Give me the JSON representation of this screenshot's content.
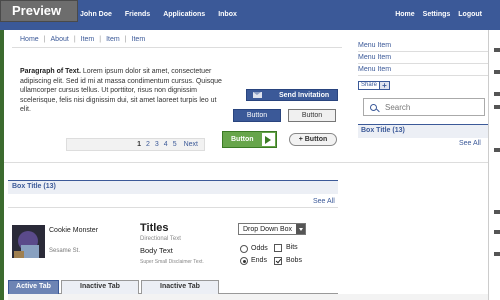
{
  "badge": "Preview",
  "topnav": {
    "left": [
      "John Doe",
      "Friends",
      "Applications",
      "Inbox"
    ],
    "right": [
      "Home",
      "Settings",
      "Logout"
    ]
  },
  "breadcrumb": [
    "Home",
    "About",
    "Item",
    "Item",
    "Item"
  ],
  "breadcrumb_separator": "|",
  "paragraph": {
    "heading": "Paragraph of Text.",
    "body": "Lorem ipsum dolor sit amet, consectetuer adipiscing elit. Sed id mi at massa condimentum cursus. Quisque ullamcorper cursus tellus. Ut porttitor, risus non dignissim scelerisque, felis nisi dignissim dui, sit amet laoreet turpis leo ut elit."
  },
  "buttons": {
    "send_invitation": "Send Invitation",
    "button_primary": "Button",
    "button_secondary": "Button",
    "button_green": "Button",
    "button_add": "+ Button"
  },
  "pager": {
    "pages": [
      "1",
      "2",
      "3",
      "4",
      "5"
    ],
    "current": "1",
    "next": "Next"
  },
  "sidebar": {
    "menu_items": [
      "Menu Item",
      "Menu Item",
      "Menu Item"
    ],
    "share_label": "Share",
    "share_plus": "+",
    "search_placeholder": "Search",
    "box_title": "Box Title (13)",
    "see_all": "See All"
  },
  "main_box": {
    "title": "Box Title (13)",
    "see_all": "See All"
  },
  "profile": {
    "name": "Cookie Monster",
    "subtitle": "Sesame St."
  },
  "typography": {
    "titles": "Titles",
    "directional": "Directional Text",
    "body": "Body Text",
    "disclaimer": "Super Small Disclaimer Text."
  },
  "form": {
    "dropdown_value": "Drop Down Box",
    "radio_options": [
      {
        "label": "Odds",
        "selected": false
      },
      {
        "label": "Ends",
        "selected": true
      }
    ],
    "checkbox_options": [
      {
        "label": "Bits",
        "checked": false
      },
      {
        "label": "Bobs",
        "checked": true
      }
    ]
  },
  "tabs": [
    {
      "label": "Active Tab",
      "active": true
    },
    {
      "label": "Inactive Tab",
      "active": false
    },
    {
      "label": "Inactive Tab",
      "active": false
    }
  ],
  "colors": {
    "brand": "#3b5998",
    "brand_light": "#eceff5",
    "green": "#67a54b"
  }
}
